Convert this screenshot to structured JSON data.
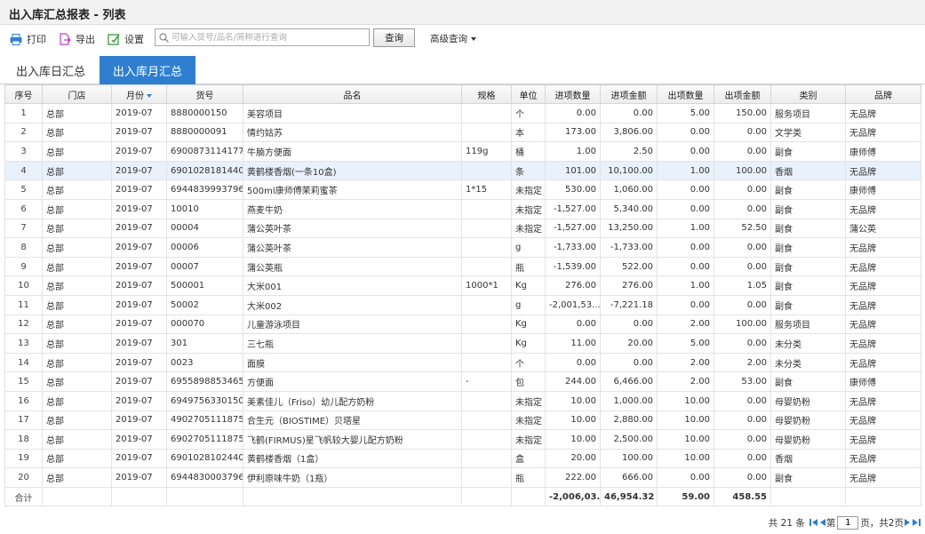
{
  "window": {
    "title": "出入库汇总报表 - 列表"
  },
  "toolbar": {
    "print_label": "打印",
    "export_label": "导出",
    "settings_label": "设置",
    "search_placeholder": "可输入货号/品名/简称进行查询",
    "search_value": "",
    "query_label": "查询",
    "advanced_label": "高级查询"
  },
  "tabs": [
    {
      "label": "出入库日汇总",
      "active": false
    },
    {
      "label": "出入库月汇总",
      "active": true
    }
  ],
  "table": {
    "columns": [
      "序号",
      "门店",
      "月份",
      "货号",
      "品名",
      "规格",
      "单位",
      "进项数量",
      "进项金额",
      "出项数量",
      "出项金额",
      "类别",
      "品牌"
    ],
    "rows": [
      [
        "1",
        "总部",
        "2019-07",
        "8880000150",
        "美容项目",
        "",
        "个",
        "0.00",
        "0.00",
        "5.00",
        "150.00",
        "服务项目",
        "无品牌"
      ],
      [
        "2",
        "总部",
        "2019-07",
        "8880000091",
        "情约姑苏",
        "",
        "本",
        "173.00",
        "3,806.00",
        "0.00",
        "0.00",
        "文学类",
        "无品牌"
      ],
      [
        "3",
        "总部",
        "2019-07",
        "6900873114177",
        "牛腩方便面",
        "119g",
        "桶",
        "1.00",
        "2.50",
        "0.00",
        "0.00",
        "副食",
        "康师傅"
      ],
      [
        "4",
        "总部",
        "2019-07",
        "6901028181440",
        "黄鹤楼香烟(一条10盒)",
        "",
        "条",
        "101.00",
        "10,100.00",
        "1.00",
        "100.00",
        "香烟",
        "无品牌"
      ],
      [
        "5",
        "总部",
        "2019-07",
        "6944839993796",
        "500ml康师傅茉莉蜜茶",
        "1*15",
        "未指定",
        "530.00",
        "1,060.00",
        "0.00",
        "0.00",
        "副食",
        "康师傅"
      ],
      [
        "6",
        "总部",
        "2019-07",
        "10010",
        "燕麦牛奶",
        "",
        "未指定",
        "-1,527.00",
        "5,340.00",
        "0.00",
        "0.00",
        "副食",
        "无品牌"
      ],
      [
        "7",
        "总部",
        "2019-07",
        "00004",
        "蒲公英叶茶",
        "",
        "未指定",
        "-1,527.00",
        "13,250.00",
        "1.00",
        "52.50",
        "副食",
        "蒲公英"
      ],
      [
        "8",
        "总部",
        "2019-07",
        "00006",
        "蒲公英叶茶",
        "",
        "g",
        "-1,733.00",
        "-1,733.00",
        "0.00",
        "0.00",
        "副食",
        "无品牌"
      ],
      [
        "9",
        "总部",
        "2019-07",
        "00007",
        "蒲公英瓶",
        "",
        "瓶",
        "-1,539.00",
        "522.00",
        "0.00",
        "0.00",
        "副食",
        "无品牌"
      ],
      [
        "10",
        "总部",
        "2019-07",
        "500001",
        "大米001",
        "1000*1",
        "Kg",
        "276.00",
        "276.00",
        "1.00",
        "1.05",
        "副食",
        "无品牌"
      ],
      [
        "11",
        "总部",
        "2019-07",
        "50002",
        "大米002",
        "",
        "g",
        "-2,001,53...",
        "-7,221.18",
        "0.00",
        "0.00",
        "副食",
        "无品牌"
      ],
      [
        "12",
        "总部",
        "2019-07",
        "000070",
        "儿童游泳项目",
        "",
        "Kg",
        "0.00",
        "0.00",
        "2.00",
        "100.00",
        "服务项目",
        "无品牌"
      ],
      [
        "13",
        "总部",
        "2019-07",
        "301",
        "三七瓶",
        "",
        "Kg",
        "11.00",
        "20.00",
        "5.00",
        "0.00",
        "未分类",
        "无品牌"
      ],
      [
        "14",
        "总部",
        "2019-07",
        "0023",
        "面膜",
        "",
        "个",
        "0.00",
        "0.00",
        "2.00",
        "2.00",
        "未分类",
        "无品牌"
      ],
      [
        "15",
        "总部",
        "2019-07",
        "6955898853465",
        "方便面",
        "-",
        "包",
        "244.00",
        "6,466.00",
        "2.00",
        "53.00",
        "副食",
        "康师傅"
      ],
      [
        "16",
        "总部",
        "2019-07",
        "6949756330150",
        "美素佳儿（Friso）幼儿配方奶粉",
        "",
        "未指定",
        "10.00",
        "1,000.00",
        "10.00",
        "0.00",
        "母婴奶粉",
        "无品牌"
      ],
      [
        "17",
        "总部",
        "2019-07",
        "4902705111875",
        "合生元（BIOSTIME）贝塔星",
        "",
        "未指定",
        "10.00",
        "2,880.00",
        "10.00",
        "0.00",
        "母婴奶粉",
        "无品牌"
      ],
      [
        "18",
        "总部",
        "2019-07",
        "6902705111875",
        "飞鹤(FIRMUS)星飞帆较大婴儿配方奶粉",
        "",
        "未指定",
        "10.00",
        "2,500.00",
        "10.00",
        "0.00",
        "母婴奶粉",
        "无品牌"
      ],
      [
        "19",
        "总部",
        "2019-07",
        "6901028102440",
        "黄鹤楼香烟（1盒）",
        "",
        "盒",
        "20.00",
        "100.00",
        "10.00",
        "0.00",
        "香烟",
        "无品牌"
      ],
      [
        "20",
        "总部",
        "2019-07",
        "6944830003796",
        "伊利原味牛奶（1瓶）",
        "",
        "瓶",
        "222.00",
        "666.00",
        "0.00",
        "0.00",
        "副食",
        "无品牌"
      ]
    ],
    "highlighted_row": 4,
    "total": {
      "label": "合计",
      "in_qty": "-2,006,03...",
      "in_amount": "46,954.32",
      "out_qty": "59.00",
      "out_amount": "458.55"
    }
  },
  "pager": {
    "total_text": "共 21 条",
    "page_prefix": "第",
    "page_value": "1",
    "page_suffix": "页，共2页"
  },
  "colors": {
    "accent": "#2f7fd0",
    "highlight_row": "#e8f1fc"
  },
  "icons": [
    "printer-icon",
    "export-icon",
    "settings-icon",
    "search-icon",
    "first-page-icon",
    "prev-page-icon",
    "next-page-icon",
    "last-page-icon"
  ]
}
